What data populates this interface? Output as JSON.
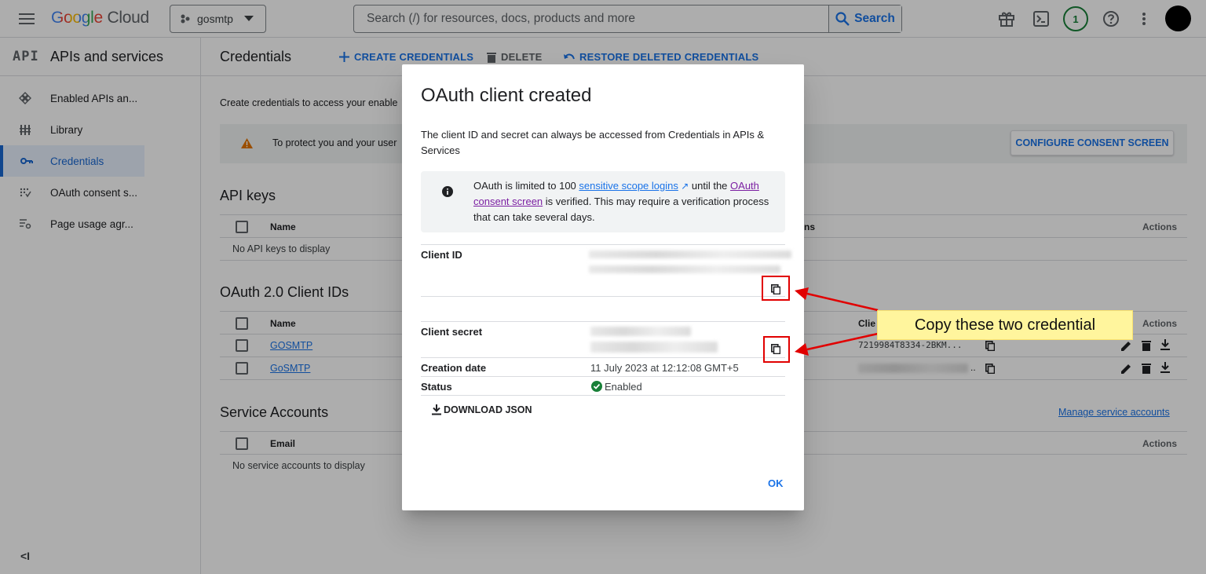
{
  "topbar": {
    "logo": {
      "google": "Google",
      "cloud": "Cloud"
    },
    "project": "gosmtp",
    "search_placeholder": "Search (/) for resources, docs, products and more",
    "search_button": "Search",
    "notification_count": "1"
  },
  "sidebar": {
    "api_badge": "API",
    "title": "APIs and services",
    "items": [
      {
        "label": "Enabled APIs an...",
        "icon": "hub-icon"
      },
      {
        "label": "Library",
        "icon": "library-icon"
      },
      {
        "label": "Credentials",
        "icon": "key-icon",
        "active": true
      },
      {
        "label": "OAuth consent s...",
        "icon": "consent-icon"
      },
      {
        "label": "Page usage agr...",
        "icon": "settings-list-icon"
      }
    ],
    "collapse_label": "<I"
  },
  "main": {
    "title": "Credentials",
    "actions": {
      "create": "CREATE CREDENTIALS",
      "delete": "DELETE",
      "restore": "RESTORE DELETED CREDENTIALS"
    },
    "intro": "Create credentials to access your enable",
    "banner_text": "To protect you and your user",
    "configure_button": "CONFIGURE CONSENT SCREEN",
    "api_keys": {
      "heading": "API keys",
      "col_name": "Name",
      "col_restrictions_tail": "ns",
      "col_actions": "Actions",
      "empty": "No API keys to display"
    },
    "oauth": {
      "heading": "OAuth 2.0 Client IDs",
      "col_name": "Name",
      "col_client": "Clie",
      "col_actions": "Actions",
      "rows": [
        {
          "name": "GOSMTP",
          "client_id": "7219984T8334-2BKM...",
          "client_tail": ".."
        },
        {
          "name": "GoSMTP",
          "client_id": "",
          "client_tail": ".."
        }
      ]
    },
    "service_accounts": {
      "heading": "Service Accounts",
      "manage_link": "Manage service accounts",
      "col_email": "Email",
      "col_actions": "Actions",
      "empty": "No service accounts to display"
    }
  },
  "dialog": {
    "title": "OAuth client created",
    "description": "The client ID and secret can always be accessed from Credentials in APIs & Services",
    "info": {
      "part1": "OAuth is limited to 100 ",
      "link1": "sensitive scope logins",
      "part2": " until the ",
      "link2": "OAuth consent screen",
      "part3": " is verified. This may require a verification process that can take several days."
    },
    "client_id_label": "Client ID",
    "client_secret_label": "Client secret",
    "creation_date_label": "Creation date",
    "creation_date_value": "11 July 2023 at 12:12:08 GMT+5",
    "status_label": "Status",
    "status_value": "Enabled",
    "download_label": "DOWNLOAD JSON",
    "ok_label": "OK"
  },
  "annotation": {
    "callout": "Copy these two credential",
    "arrow_color": "#e10000"
  }
}
